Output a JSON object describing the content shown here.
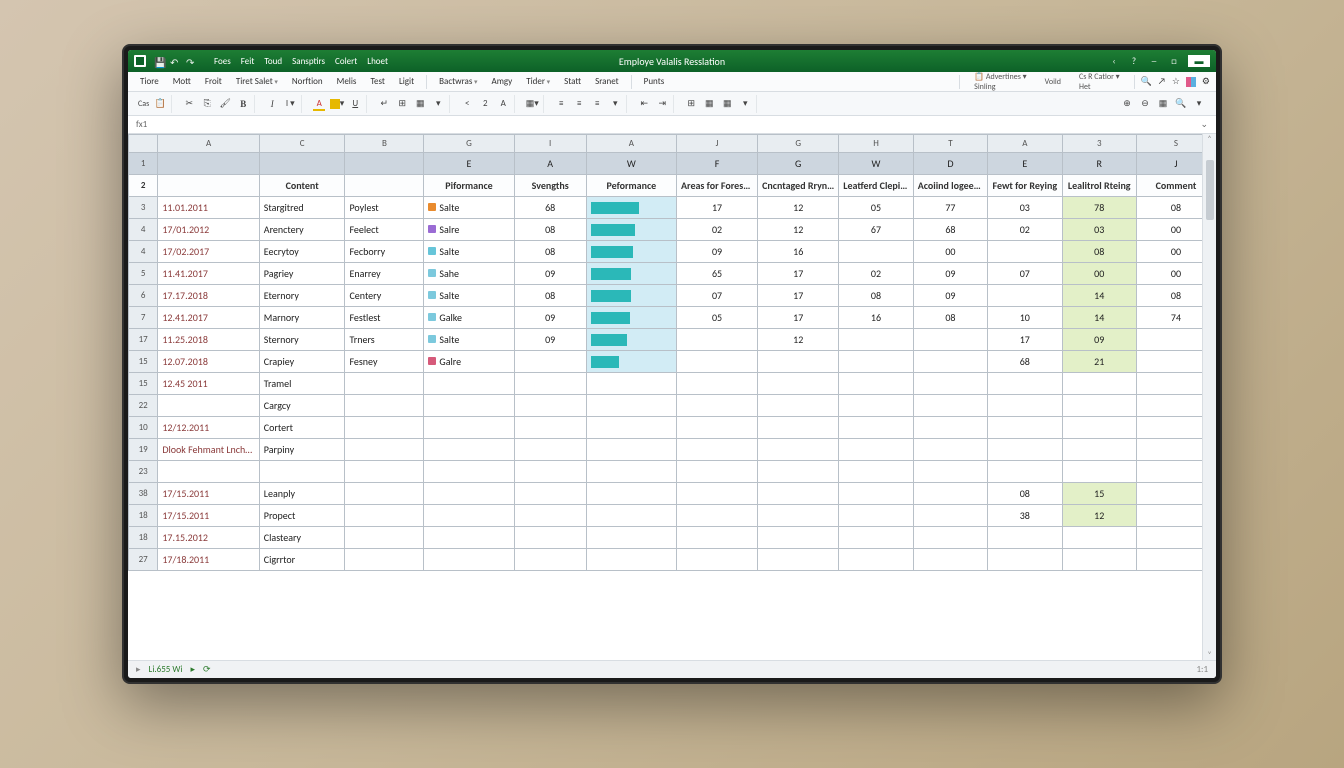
{
  "window": {
    "title": "Employe Valalis Resslation",
    "qat": [
      "save-icon",
      "undo-icon",
      "redo-icon"
    ],
    "win_controls": [
      "minimize",
      "maximize",
      "close"
    ]
  },
  "menubar": {
    "items": [
      "Tiore",
      "Mott",
      "Froit",
      "Tiret Salet",
      "Norftion",
      "Melis",
      "Test",
      "Ligit"
    ],
    "items2": [
      "Bactwras",
      "Amgy",
      "Tider",
      "Statt",
      "Sranet"
    ],
    "items3": [
      "Punts"
    ],
    "group1": {
      "top": "Advertines",
      "bot": "Sinling"
    },
    "group2": {
      "top": "Voild"
    },
    "group3": {
      "top": "Cs R Catlor",
      "bot": "Het"
    }
  },
  "toolbar": {
    "paste": "Cas"
  },
  "namebox": "fx1",
  "columns": [
    "",
    "A",
    "C",
    "B",
    "G",
    "I",
    "A",
    "J",
    "G",
    "H",
    "T",
    "A",
    "3",
    "S"
  ],
  "subcols": [
    "1",
    "",
    "",
    "",
    "E",
    "A",
    "W",
    "F",
    "G",
    "W",
    "D",
    "E",
    "R",
    "J"
  ],
  "headers": [
    "2",
    "",
    "Content",
    "",
    "Piformance",
    "Svengths",
    "Peformance",
    "Areas for Foresrging",
    "Cncntaged Rrynting",
    "Leatferd Cleping",
    "Acoiind logeeting",
    "Fewt for Reying",
    "Lealitrol Rteing",
    "Comment"
  ],
  "rows": [
    {
      "n": "3",
      "date": "11.01.2011",
      "c": "Stargitred",
      "b": "Poylest",
      "tag": {
        "color": "#e98b2e",
        "label": "Salte"
      },
      "s": "68",
      "pbar": 60,
      "f": "17",
      "g": "12",
      "h": "05",
      "t": "77",
      "a": "03",
      "r": "78",
      "j": "08"
    },
    {
      "n": "4",
      "date": "17/01.2012",
      "c": "Arenctery",
      "b": "Feelect",
      "tag": {
        "color": "#9a6bd4",
        "label": "Salre"
      },
      "s": "08",
      "pbar": 55,
      "f": "02",
      "g": "12",
      "h": "67",
      "t": "68",
      "a": "02",
      "r": "03",
      "j": "00"
    },
    {
      "n": "4",
      "date": "17/02.2017",
      "c": "Eecrytoy",
      "b": "Fecborry",
      "tag": {
        "color": "#66c5d9",
        "label": "Salte"
      },
      "s": "08",
      "pbar": 52,
      "f": "09",
      "g": "16",
      "h": "",
      "t": "00",
      "a": "",
      "r": "08",
      "j": "00"
    },
    {
      "n": "5",
      "date": "11.41.2017",
      "c": "Pagriey",
      "b": "Enarrey",
      "tag": {
        "color": "#7cc9dd",
        "label": "Sahe"
      },
      "s": "09",
      "pbar": 50,
      "f": "65",
      "g": "17",
      "h": "02",
      "t": "09",
      "a": "07",
      "r": "00",
      "j": "00"
    },
    {
      "n": "6",
      "date": "17.17.2018",
      "c": "Eternory",
      "b": "Centery",
      "tag": {
        "color": "#7cc9dd",
        "label": "Salte"
      },
      "s": "08",
      "pbar": 50,
      "f": "07",
      "g": "17",
      "h": "08",
      "t": "09",
      "a": "",
      "r": "14",
      "j": "08"
    },
    {
      "n": "7",
      "date": "12.41.2017",
      "c": "Marnory",
      "b": "Festlest",
      "tag": {
        "color": "#7cc9dd",
        "label": "Galke"
      },
      "s": "09",
      "pbar": 48,
      "f": "05",
      "g": "17",
      "h": "16",
      "t": "08",
      "a": "10",
      "r": "14",
      "j": "74"
    },
    {
      "n": "17",
      "date": "11.25.2018",
      "c": "Sternory",
      "b": "Trners",
      "tag": {
        "color": "#7cc9dd",
        "label": "Salte"
      },
      "s": "09",
      "pbar": 45,
      "f": "",
      "g": "12",
      "h": "",
      "t": "",
      "a": "17",
      "r": "09",
      "j": ""
    },
    {
      "n": "15",
      "date": "12.07.2018",
      "c": "Crapiey",
      "b": "Fesney",
      "tag": {
        "color": "#d65a7a",
        "label": "Galre"
      },
      "s": "",
      "pbar": 35,
      "f": "",
      "g": "",
      "h": "",
      "t": "",
      "a": "68",
      "r": "21",
      "j": ""
    },
    {
      "n": "15",
      "date": "12.45 2011",
      "c": "Tramel",
      "b": "",
      "tag": null,
      "s": "",
      "pbar": null,
      "f": "",
      "g": "",
      "h": "",
      "t": "",
      "a": "",
      "r": "",
      "j": ""
    },
    {
      "n": "22",
      "date": "",
      "c": "Cargcy",
      "b": "",
      "tag": null,
      "s": "",
      "pbar": null,
      "f": "",
      "g": "",
      "h": "",
      "t": "",
      "a": "",
      "r": "",
      "j": ""
    },
    {
      "n": "10",
      "date": "12/12.2011",
      "c": "Cortert",
      "b": "",
      "tag": null,
      "s": "",
      "pbar": null,
      "f": "",
      "g": "",
      "h": "",
      "t": "",
      "a": "",
      "r": "",
      "j": ""
    },
    {
      "n": "19",
      "date": "Dlook Fehmant Lnchesl",
      "c": "Parpiny",
      "b": "",
      "tag": null,
      "s": "",
      "pbar": null,
      "f": "",
      "g": "",
      "h": "",
      "t": "",
      "a": "",
      "r": "",
      "j": ""
    },
    {
      "n": "23",
      "date": "",
      "c": "",
      "b": "",
      "tag": null,
      "s": "",
      "pbar": null,
      "f": "",
      "g": "",
      "h": "",
      "t": "",
      "a": "",
      "r": "",
      "j": ""
    },
    {
      "n": "38",
      "date": "17/15.2011",
      "c": "Leanply",
      "b": "",
      "tag": null,
      "s": "",
      "pbar": null,
      "f": "",
      "g": "",
      "h": "",
      "t": "",
      "a": "08",
      "r": "15",
      "j": ""
    },
    {
      "n": "18",
      "date": "17/15.2011",
      "c": "Propect",
      "b": "",
      "tag": null,
      "s": "",
      "pbar": null,
      "f": "",
      "g": "",
      "h": "",
      "t": "",
      "a": "38",
      "r": "12",
      "j": ""
    },
    {
      "n": "18",
      "date": "17.15.2012",
      "c": "Clasteary",
      "b": "",
      "tag": null,
      "s": "",
      "pbar": null,
      "f": "",
      "g": "",
      "h": "",
      "t": "",
      "a": "",
      "r": "",
      "j": ""
    },
    {
      "n": "27",
      "date": "17/18.2011",
      "c": "Cigrrtor",
      "b": "",
      "tag": null,
      "s": "",
      "pbar": null,
      "f": "",
      "g": "",
      "h": "",
      "t": "",
      "a": "",
      "r": "",
      "j": ""
    }
  ],
  "status": {
    "left": "Li.655 Wi",
    "right": "1:1"
  },
  "tag_colors": {
    "orange": "#e98b2e",
    "purple": "#9a6bd4",
    "cyan": "#66c5d9",
    "lcyan": "#7cc9dd",
    "pink": "#d65a7a"
  }
}
